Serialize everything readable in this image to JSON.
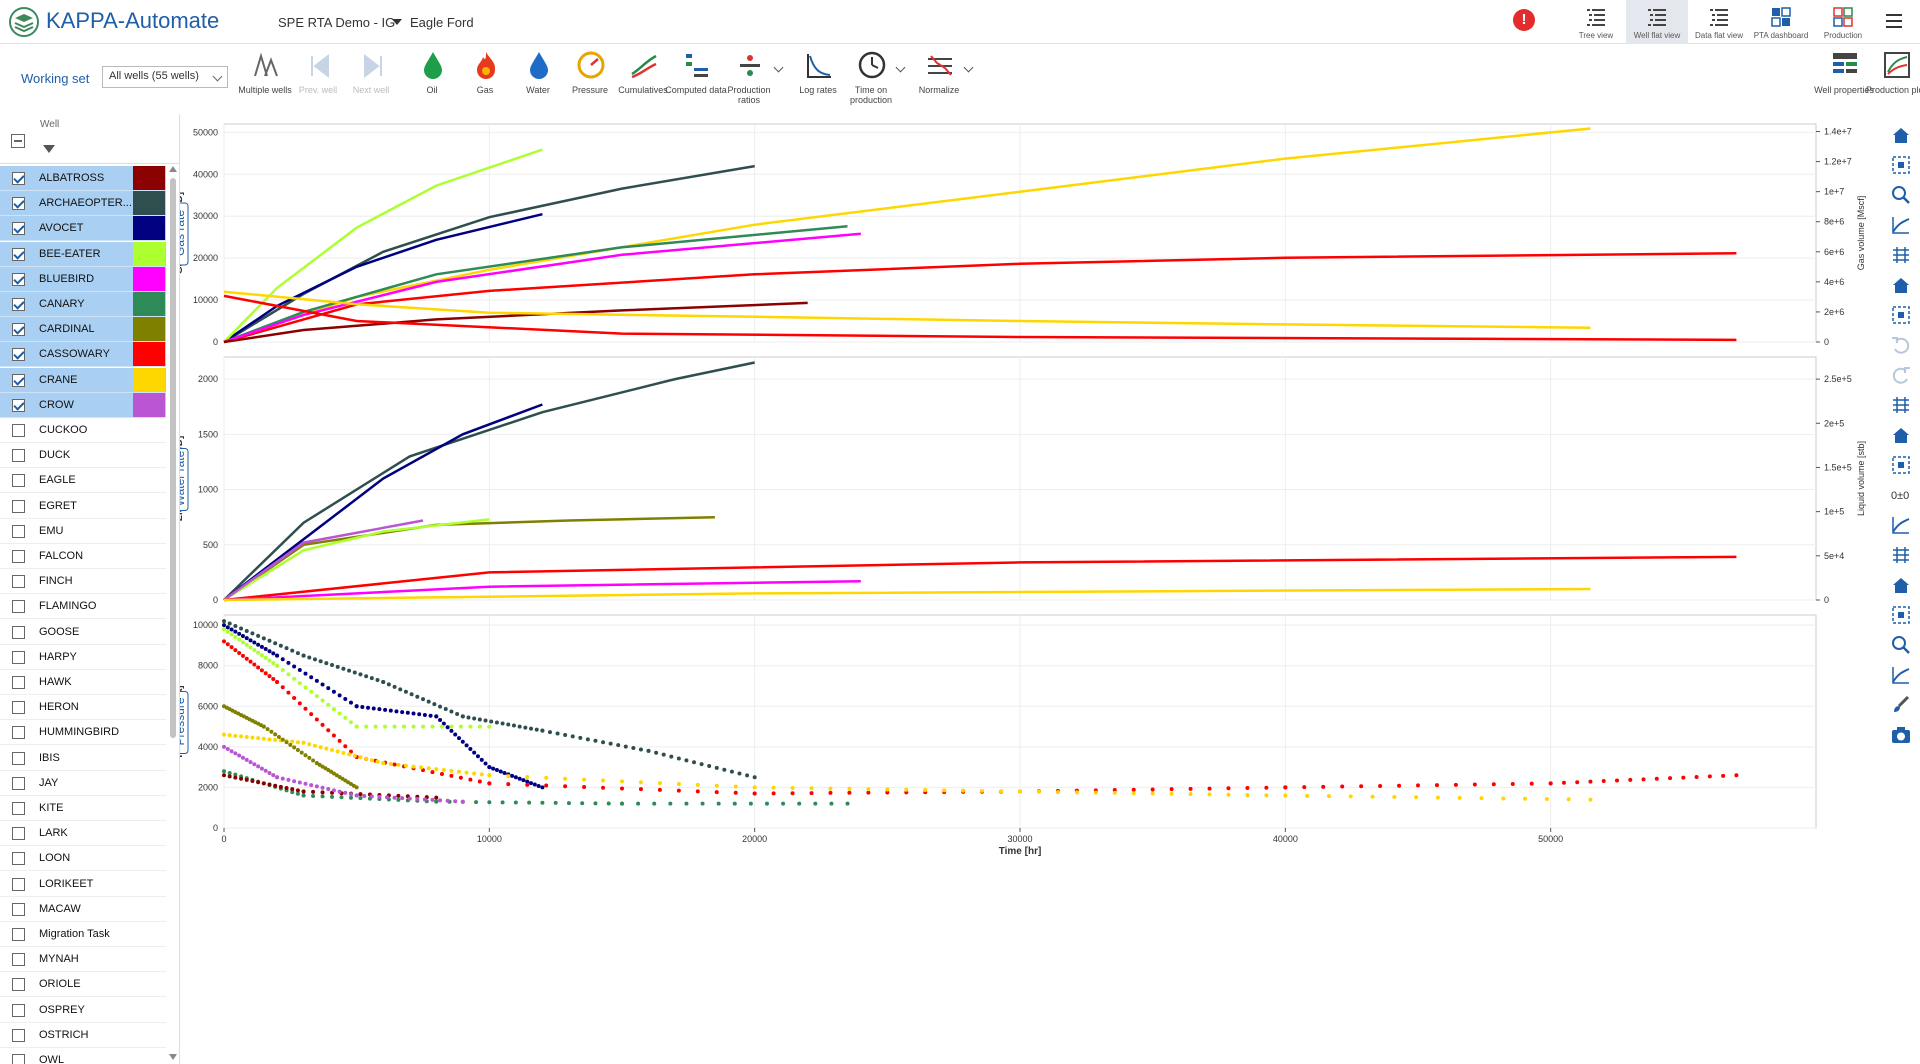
{
  "header": {
    "app_title": "KAPPA-Automate",
    "project": "SPE RTA Demo - IG",
    "field": "Eagle Ford",
    "alert": "!",
    "views": [
      {
        "label": "Tree view",
        "icon": "tree-view-icon"
      },
      {
        "label": "Well flat view",
        "icon": "well-flat-view-icon",
        "active": true
      },
      {
        "label": "Data flat view",
        "icon": "data-flat-view-icon"
      },
      {
        "label": "PTA dashboard",
        "icon": "pta-dashboard-icon"
      },
      {
        "label": "Production",
        "icon": "production-icon"
      }
    ]
  },
  "toolbar": {
    "working_set_label": "Working set",
    "working_set_value": "All wells (55 wells)",
    "tools": [
      {
        "label": "Multiple wells",
        "icon": "multiple-wells-icon"
      },
      {
        "label": "Prev. well",
        "icon": "prev-well-icon",
        "disabled": true
      },
      {
        "label": "Next well",
        "icon": "next-well-icon",
        "disabled": true
      },
      {
        "label": "Oil",
        "icon": "oil-drop-icon"
      },
      {
        "label": "Gas",
        "icon": "gas-flame-icon"
      },
      {
        "label": "Water",
        "icon": "water-drop-icon"
      },
      {
        "label": "Pressure",
        "icon": "pressure-gauge-icon"
      },
      {
        "label": "Cumulatives",
        "icon": "cumulatives-icon"
      },
      {
        "label": "Computed data",
        "icon": "computed-data-icon"
      },
      {
        "label": "Production ratios",
        "icon": "production-ratios-icon"
      },
      {
        "label": "Log rates",
        "icon": "log-rates-icon"
      },
      {
        "label": "Time on production",
        "icon": "time-on-production-icon"
      },
      {
        "label": "Normalize",
        "icon": "normalize-icon"
      },
      {
        "label": "Well properties",
        "icon": "well-properties-icon"
      },
      {
        "label": "Production plot",
        "icon": "production-plot-icon"
      }
    ]
  },
  "well_list": {
    "header": "Well",
    "wells": [
      {
        "name": "ALBATROSS",
        "selected": true,
        "color": "#8b0000"
      },
      {
        "name": "ARCHAEOPTER...",
        "selected": true,
        "color": "#2f4f4f"
      },
      {
        "name": "AVOCET",
        "selected": true,
        "color": "#000080"
      },
      {
        "name": "BEE-EATER",
        "selected": true,
        "color": "#adff2f"
      },
      {
        "name": "BLUEBIRD",
        "selected": true,
        "color": "#ff00ff"
      },
      {
        "name": "CANARY",
        "selected": true,
        "color": "#2e8b57"
      },
      {
        "name": "CARDINAL",
        "selected": true,
        "color": "#808000"
      },
      {
        "name": "CASSOWARY",
        "selected": true,
        "color": "#ff0000"
      },
      {
        "name": "CRANE",
        "selected": true,
        "color": "#ffd700"
      },
      {
        "name": "CROW",
        "selected": true,
        "color": "#ba55d3"
      },
      {
        "name": "CUCKOO"
      },
      {
        "name": "DUCK"
      },
      {
        "name": "EAGLE"
      },
      {
        "name": "EGRET"
      },
      {
        "name": "EMU"
      },
      {
        "name": "FALCON"
      },
      {
        "name": "FINCH"
      },
      {
        "name": "FLAMINGO"
      },
      {
        "name": "GOOSE"
      },
      {
        "name": "HARPY"
      },
      {
        "name": "HAWK"
      },
      {
        "name": "HERON"
      },
      {
        "name": "HUMMINGBIRD"
      },
      {
        "name": "IBIS"
      },
      {
        "name": "JAY"
      },
      {
        "name": "KITE"
      },
      {
        "name": "LARK"
      },
      {
        "name": "LOON"
      },
      {
        "name": "LORIKEET"
      },
      {
        "name": "MACAW"
      },
      {
        "name": "Migration Task"
      },
      {
        "name": "MYNAH"
      },
      {
        "name": "ORIOLE"
      },
      {
        "name": "OSPREY"
      },
      {
        "name": "OSTRICH"
      },
      {
        "name": "OWL"
      }
    ]
  },
  "plots": {
    "xlabel": "Time [hr]",
    "x_ticks": [
      0,
      10000,
      20000,
      30000,
      40000,
      50000
    ],
    "x_tick_labels": [
      "0",
      "10000",
      "20000",
      "30000",
      "40000",
      "50000"
    ],
    "xlim": [
      0,
      60000
    ],
    "panels": [
      {
        "tab": "Gas rate",
        "ylabel": "Gas rate [Mscf/D]",
        "ylim": [
          0,
          52000
        ],
        "y_ticks": [
          0,
          10000,
          20000,
          30000,
          40000,
          50000
        ],
        "y_tick_labels": [
          "0",
          "10000",
          "20000",
          "30000",
          "40000",
          "50000"
        ],
        "y2label": "Gas volume [Mscf]",
        "y2lim": [
          0,
          14500000
        ],
        "y2_ticks": [
          0,
          2000000,
          4000000,
          6000000,
          8000000,
          10000000,
          12000000,
          14000000
        ],
        "y2_tick_labels": [
          "0",
          "2e+6",
          "4e+6",
          "6e+6",
          "8e+6",
          "1e+7",
          "1.2e+7",
          "1.4e+7"
        ]
      },
      {
        "tab": "Water rate",
        "ylabel": "Liquid rate [stb/D]",
        "ylim": [
          0,
          2200
        ],
        "y_ticks": [
          0,
          500,
          1000,
          1500,
          2000
        ],
        "y_tick_labels": [
          "0",
          "500",
          "1000",
          "1500",
          "2000"
        ],
        "y2label": "Liquid volume [stb]",
        "y2lim": [
          0,
          275000
        ],
        "y2_ticks": [
          0,
          50000,
          100000,
          150000,
          200000,
          250000
        ],
        "y2_tick_labels": [
          "0",
          "5e+4",
          "1e+5",
          "1.5e+5",
          "2e+5",
          "2.5e+5"
        ]
      },
      {
        "tab": "Pressure",
        "ylabel": "Pressure [psia]",
        "ylim": [
          0,
          10500
        ],
        "y_ticks": [
          0,
          2000,
          4000,
          6000,
          8000,
          10000
        ],
        "y_tick_labels": [
          "0",
          "2000",
          "4000",
          "6000",
          "8000",
          "10000"
        ]
      }
    ]
  },
  "chart_data": [
    {
      "type": "line",
      "xlabel": "Time [hr]",
      "ylabel": "Gas rate [Mscf/D]",
      "y2label": "Gas volume [Mscf]",
      "xlim": [
        0,
        60000
      ],
      "ylim": [
        0,
        52000
      ],
      "y2lim": [
        0,
        14500000
      ],
      "series": [
        {
          "well": "CRANE",
          "color": "#ffd700",
          "axis": "y2",
          "x": [
            0,
            5000,
            10000,
            20000,
            30000,
            40000,
            51500
          ],
          "y": [
            0,
            3000000,
            4800000,
            7800000,
            10000000,
            12200000,
            14200000
          ]
        },
        {
          "well": "CASSOWARY",
          "color": "#ff0000",
          "axis": "y2",
          "x": [
            0,
            5000,
            10000,
            20000,
            30000,
            40000,
            57000
          ],
          "y": [
            0,
            2500000,
            3400000,
            4500000,
            5200000,
            5600000,
            5900000
          ]
        },
        {
          "well": "ARCHAEOPTER...",
          "color": "#2f4f4f",
          "axis": "y2",
          "x": [
            0,
            3000,
            6000,
            10000,
            15000,
            20000
          ],
          "y": [
            0,
            3200000,
            6000000,
            8300000,
            10200000,
            11700000
          ]
        },
        {
          "well": "AVOCET",
          "color": "#000080",
          "axis": "y2",
          "x": [
            0,
            2000,
            5000,
            8000,
            12000
          ],
          "y": [
            0,
            2400000,
            5000000,
            6800000,
            8500000
          ]
        },
        {
          "well": "BEE-EATER",
          "color": "#adff2f",
          "axis": "y2",
          "x": [
            0,
            2000,
            5000,
            8000,
            12000
          ],
          "y": [
            0,
            3600000,
            7600000,
            10400000,
            12800000
          ]
        },
        {
          "well": "CANARY",
          "color": "#2e8b57",
          "axis": "y2",
          "x": [
            0,
            3000,
            8000,
            15000,
            23500
          ],
          "y": [
            0,
            2000000,
            4500000,
            6300000,
            7700000
          ]
        },
        {
          "well": "BLUEBIRD",
          "color": "#ff00ff",
          "axis": "y2",
          "x": [
            0,
            3000,
            8000,
            15000,
            24000
          ],
          "y": [
            0,
            1800000,
            4000000,
            5800000,
            7200000
          ]
        },
        {
          "well": "ALBATROSS",
          "color": "#8b0000",
          "axis": "y2",
          "x": [
            0,
            3000,
            8000,
            15000,
            22000
          ],
          "y": [
            0,
            800000,
            1500000,
            2100000,
            2600000
          ]
        },
        {
          "well": "CASSOWARY",
          "color": "#ff0000",
          "axis": "y",
          "x": [
            0,
            5000,
            15000,
            30000,
            57000
          ],
          "y": [
            11000,
            5000,
            2000,
            1200,
            500
          ]
        },
        {
          "well": "CRANE",
          "color": "#ffd700",
          "axis": "y",
          "x": [
            0,
            5000,
            10000,
            20000,
            30000,
            40000,
            51500
          ],
          "y": [
            12000,
            9000,
            7000,
            6000,
            5000,
            4200,
            3400
          ]
        }
      ]
    },
    {
      "type": "line",
      "xlabel": "Time [hr]",
      "ylabel": "Liquid rate [stb/D]",
      "y2label": "Liquid volume [stb]",
      "xlim": [
        0,
        60000
      ],
      "ylim": [
        0,
        2200
      ],
      "y2lim": [
        0,
        275000
      ],
      "series": [
        {
          "well": "ARCHAEOPTER...",
          "color": "#2f4f4f",
          "axis": "y",
          "x": [
            0,
            3000,
            7000,
            12000,
            17000,
            20000
          ],
          "y": [
            0,
            700,
            1300,
            1700,
            2000,
            2150
          ]
        },
        {
          "well": "AVOCET",
          "color": "#000080",
          "axis": "y",
          "x": [
            0,
            3000,
            6000,
            9000,
            12000
          ],
          "y": [
            0,
            550,
            1100,
            1500,
            1770
          ]
        },
        {
          "well": "CARDINAL",
          "color": "#808000",
          "axis": "y",
          "x": [
            0,
            3000,
            8000,
            13000,
            18500
          ],
          "y": [
            0,
            500,
            680,
            720,
            750
          ]
        },
        {
          "well": "BEE-EATER",
          "color": "#adff2f",
          "axis": "y",
          "x": [
            0,
            3000,
            6000,
            10000
          ],
          "y": [
            0,
            450,
            620,
            730
          ]
        },
        {
          "well": "CROW",
          "color": "#ba55d3",
          "axis": "y",
          "x": [
            0,
            3000,
            7500
          ],
          "y": [
            0,
            520,
            720
          ]
        },
        {
          "well": "CASSOWARY",
          "color": "#ff0000",
          "axis": "y",
          "x": [
            0,
            10000,
            30000,
            57000
          ],
          "y": [
            0,
            250,
            340,
            390
          ]
        },
        {
          "well": "BLUEBIRD",
          "color": "#ff00ff",
          "axis": "y",
          "x": [
            0,
            10000,
            24000
          ],
          "y": [
            0,
            120,
            170
          ]
        },
        {
          "well": "CRANE",
          "color": "#ffd700",
          "axis": "y",
          "x": [
            0,
            20000,
            51500
          ],
          "y": [
            0,
            60,
            100
          ]
        }
      ]
    },
    {
      "type": "scatter",
      "xlabel": "Time [hr]",
      "ylabel": "Pressure [psia]",
      "xlim": [
        0,
        60000
      ],
      "ylim": [
        0,
        10500
      ],
      "series": [
        {
          "well": "ARCHAEOPTER...",
          "color": "#2f4f4f",
          "x": [
            0,
            3000,
            6000,
            9000,
            12000,
            16000,
            20000
          ],
          "y": [
            10200,
            8500,
            7200,
            5500,
            4800,
            3800,
            2500
          ]
        },
        {
          "well": "AVOCET",
          "color": "#000080",
          "x": [
            0,
            2000,
            5000,
            8000,
            10000,
            12000
          ],
          "y": [
            10000,
            8500,
            6000,
            5500,
            3000,
            2000
          ]
        },
        {
          "well": "BEE-EATER",
          "color": "#adff2f",
          "x": [
            0,
            2000,
            5000,
            10000
          ],
          "y": [
            9800,
            8000,
            5000,
            5000
          ]
        },
        {
          "well": "CASSOWARY",
          "color": "#ff0000",
          "x": [
            0,
            2000,
            5000,
            10000,
            20000,
            30000,
            40000,
            50000,
            57000
          ],
          "y": [
            9200,
            7200,
            3500,
            2200,
            1700,
            1800,
            2000,
            2200,
            2600
          ]
        },
        {
          "well": "CRANE",
          "color": "#ffd700",
          "x": [
            0,
            3000,
            6000,
            10000,
            20000,
            30000,
            40000,
            51500
          ],
          "y": [
            4600,
            4200,
            3200,
            2600,
            2000,
            1800,
            1600,
            1400
          ]
        },
        {
          "well": "CANARY",
          "color": "#2e8b57",
          "x": [
            0,
            3000,
            8000,
            15000,
            23500
          ],
          "y": [
            2800,
            1600,
            1300,
            1200,
            1200
          ]
        },
        {
          "well": "ALBATROSS",
          "color": "#8b0000",
          "x": [
            0,
            3000,
            8000
          ],
          "y": [
            2600,
            1800,
            1500
          ]
        },
        {
          "well": "CROW",
          "color": "#ba55d3",
          "x": [
            0,
            2000,
            5000,
            9000
          ],
          "y": [
            4000,
            2500,
            1600,
            1300
          ]
        },
        {
          "well": "CARDINAL",
          "color": "#808000",
          "x": [
            0,
            1500,
            3500,
            5000
          ],
          "y": [
            6000,
            5000,
            3200,
            2000
          ]
        }
      ]
    }
  ]
}
